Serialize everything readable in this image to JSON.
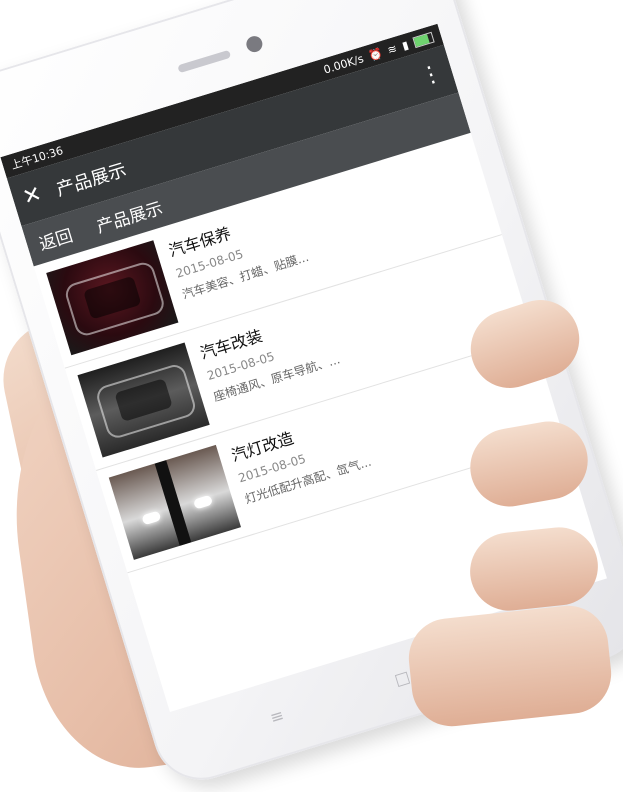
{
  "status": {
    "time": "上午10:36",
    "network": "0.00K/s",
    "icons": [
      "alarm-icon",
      "wifi-icon",
      "signal-icon",
      "battery-icon"
    ]
  },
  "titlebar": {
    "close_icon": "close-icon",
    "title": "产品展示",
    "menu_icon": "more-vertical-icon"
  },
  "subnav": {
    "back": "返回",
    "title": "产品展示"
  },
  "items": [
    {
      "title": "汽车保养",
      "date": "2015-08-05",
      "desc": "汽车美容、打蜡、贴膜..."
    },
    {
      "title": "汽车改装",
      "date": "2015-08-05",
      "desc": "座椅通风、原车导航、..."
    },
    {
      "title": "汽灯改造",
      "date": "2015-08-05",
      "desc": "灯光低配升高配、氙气..."
    }
  ],
  "navkeys": [
    "≡",
    "□",
    "‹"
  ],
  "colors": {
    "statusbar": "#222222",
    "titlebar": "#35383a",
    "subnav": "#4a4d50"
  }
}
